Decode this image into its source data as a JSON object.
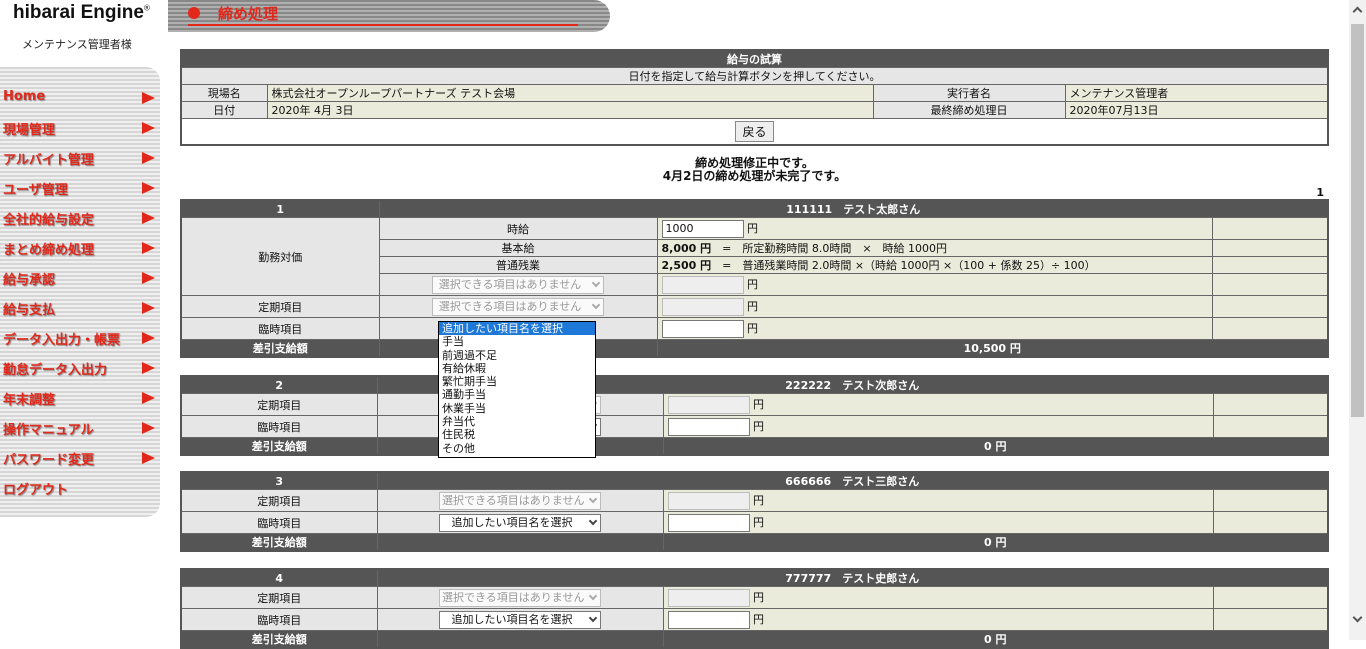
{
  "brand": {
    "name": "hibarai",
    "engine": "Engine",
    "reg": "®"
  },
  "admin_user": "メンテナンス管理者様",
  "page_title": "締め処理",
  "menu": [
    "Home",
    "現場管理",
    "アルバイト管理",
    "ユーザ管理",
    "全社的給与設定",
    "まとめ締め処理",
    "給与承認",
    "給与支払",
    "データ入出力・帳票",
    "勤怠データ入出力",
    "年末調整",
    "操作マニュアル",
    "パスワード変更",
    "ログアウト"
  ],
  "info": {
    "title": "給与の試算",
    "instruction": "日付を指定して給与計算ボタンを押してください。",
    "site_label": "現場名",
    "site_value": "株式会社オープンループパートナーズ テスト会場",
    "executor_label": "実行者名",
    "executor_value": "メンテナンス管理者",
    "date_label": "日付",
    "date_value": "2020年 4月 3日",
    "last_close_label": "最終締め処理日",
    "last_close_value": "2020年07月13日",
    "back_button": "戻る"
  },
  "messages": [
    "締め処理修正中です。",
    "4月2日の締め処理が未完了です。"
  ],
  "page_number": "1",
  "labels": {
    "work_value": "勤務対価",
    "hourly": "時給",
    "base": "基本給",
    "overtime": "普通残業",
    "fixed": "定期項目",
    "temp": "臨時項目",
    "net_pay": "差引支給額",
    "yen": "円",
    "no_options": "選択できる項目はありません",
    "select_prompt": "追加したい項目名を選択"
  },
  "employee1": {
    "no": "1",
    "header": "111111　テスト太郎さん",
    "hourly_value": "1000",
    "base_amount": "8,000 円",
    "base_formula": "=　所定勤務時間 8.0時間　×　時給 1000円",
    "ot_amount": "2,500 円",
    "ot_formula": "=　普通残業時間 2.0時間 ×（時給 1000円 ×（100 + 係数 25）÷ 100）",
    "net": "10,500 円"
  },
  "employee2": {
    "no": "2",
    "header": "222222　テスト次郎さん",
    "net": "0 円"
  },
  "employee3": {
    "no": "3",
    "header": "666666　テスト三郎さん",
    "net": "0 円"
  },
  "employee4": {
    "no": "4",
    "header": "777777　テスト史郎さん",
    "net": "0 円"
  },
  "dropdown_options": [
    "追加したい項目名を選択",
    "手当",
    "前週過不足",
    "有給休暇",
    "繁忙期手当",
    "通勤手当",
    "休業手当",
    "弁当代",
    "住民税",
    "その他"
  ]
}
